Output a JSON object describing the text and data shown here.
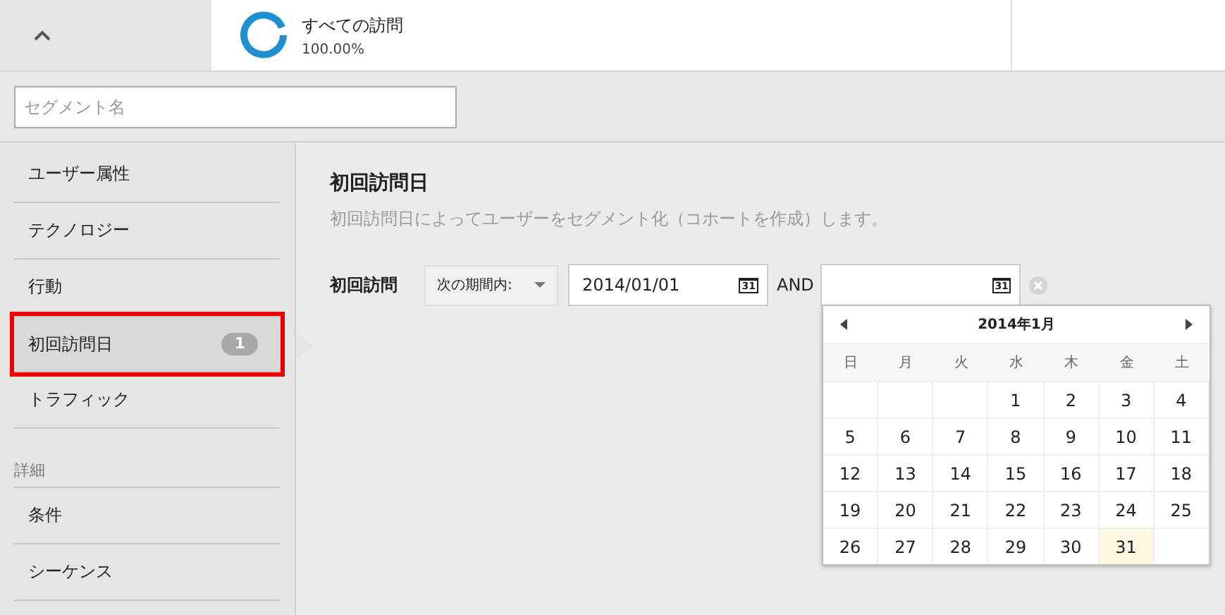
{
  "top_bar": {
    "segment": {
      "title": "すべての訪問",
      "percent": "100.00%"
    }
  },
  "segment_name": {
    "placeholder": "セグメント名"
  },
  "sidebar": {
    "items": [
      {
        "label": "ユーザー属性",
        "selected": false,
        "highlighted": false
      },
      {
        "label": "テクノロジー",
        "selected": false,
        "highlighted": false
      },
      {
        "label": "行動",
        "selected": false,
        "highlighted": false
      },
      {
        "label": "初回訪問日",
        "selected": true,
        "highlighted": true,
        "badge": "1"
      },
      {
        "label": "トラフィック",
        "selected": false,
        "highlighted": false
      }
    ],
    "section_heading": "詳細",
    "advanced_items": [
      {
        "label": "条件",
        "selected": false,
        "highlighted": false
      },
      {
        "label": "シーケンス",
        "selected": false,
        "highlighted": false
      }
    ]
  },
  "main": {
    "title": "初回訪問日",
    "description": "初回訪問日によってユーザーをセグメント化（コホートを作成）します。",
    "filter": {
      "label": "初回訪問",
      "operator": "次の期間内:",
      "start_date": "2014/01/01",
      "start_icon_text": "31",
      "conjunction": "AND",
      "end_icon_text": "31"
    },
    "calendar": {
      "month": "2014年1月",
      "weekdays": [
        "日",
        "月",
        "火",
        "水",
        "木",
        "金",
        "土"
      ],
      "weeks": [
        [
          {
            "kind": "blank"
          },
          {
            "kind": "blank"
          },
          {
            "kind": "blank"
          },
          {
            "kind": "day",
            "day": "1",
            "today": false
          },
          {
            "day": "2",
            "today": false
          },
          {
            "day": "3",
            "today": false
          },
          {
            "day": "4",
            "today": false
          }
        ],
        [
          {
            "day": "5",
            "today": false
          },
          {
            "day": "6",
            "today": false
          },
          {
            "day": "7",
            "today": false
          },
          {
            "day": "8",
            "today": false
          },
          {
            "day": "9",
            "today": false
          },
          {
            "day": "10",
            "today": false
          },
          {
            "day": "11",
            "today": false
          }
        ],
        [
          {
            "day": "12",
            "today": false
          },
          {
            "day": "13",
            "today": false
          },
          {
            "day": "14",
            "today": false
          },
          {
            "day": "15",
            "today": false
          },
          {
            "day": "16",
            "today": false
          },
          {
            "day": "17",
            "today": false
          },
          {
            "day": "18",
            "today": false
          }
        ],
        [
          {
            "day": "19",
            "today": false
          },
          {
            "day": "20",
            "today": false
          },
          {
            "day": "21",
            "today": false
          },
          {
            "day": "22",
            "today": false
          },
          {
            "day": "23",
            "today": false
          },
          {
            "day": "24",
            "today": false
          },
          {
            "day": "25",
            "today": false
          }
        ],
        [
          {
            "day": "26",
            "today": false
          },
          {
            "day": "27",
            "today": false
          },
          {
            "day": "28",
            "today": false
          },
          {
            "day": "29",
            "today": false
          },
          {
            "day": "30",
            "today": false
          },
          {
            "day": "31",
            "today": true
          },
          {
            "kind": "blank"
          }
        ]
      ]
    }
  }
}
